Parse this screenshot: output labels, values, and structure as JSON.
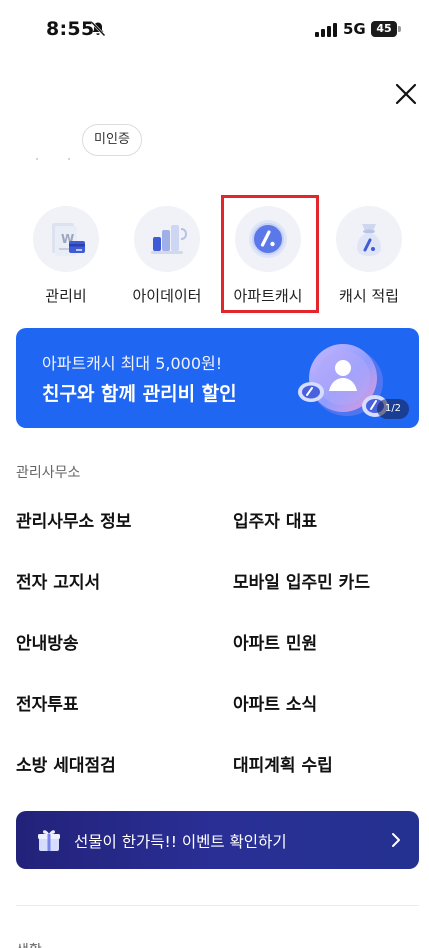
{
  "status_bar": {
    "time": "8:55",
    "network": "5G",
    "battery": "45"
  },
  "profile": {
    "verify_badge": "미인증"
  },
  "quick_menu": [
    {
      "label": "관리비",
      "icon": "bill-icon"
    },
    {
      "label": "아이데이터",
      "icon": "data-icon"
    },
    {
      "label": "아파트캐시",
      "icon": "cash-coin-icon"
    },
    {
      "label": "캐시 적립",
      "icon": "money-bag-icon"
    }
  ],
  "banner": {
    "subtitle": "아파트캐시 최대 5,000원!",
    "title": "친구와 함께 관리비 할인",
    "pager": "1/2"
  },
  "section": {
    "title": "관리사무소"
  },
  "menu": [
    "관리사무소 정보",
    "입주자 대표",
    "전자 고지서",
    "모바일 입주민 카드",
    "안내방송",
    "아파트 민원",
    "전자투표",
    "아파트 소식",
    "소방 세대점검",
    "대피계획 수립"
  ],
  "event_banner": {
    "text": "선물이 한가득!! 이벤트 확인하기"
  },
  "bottom_section": {
    "title": "생활"
  },
  "colors": {
    "accent_blue": "#1f66f2",
    "event_navy": "#23227a",
    "highlight_red": "#e3262c"
  }
}
